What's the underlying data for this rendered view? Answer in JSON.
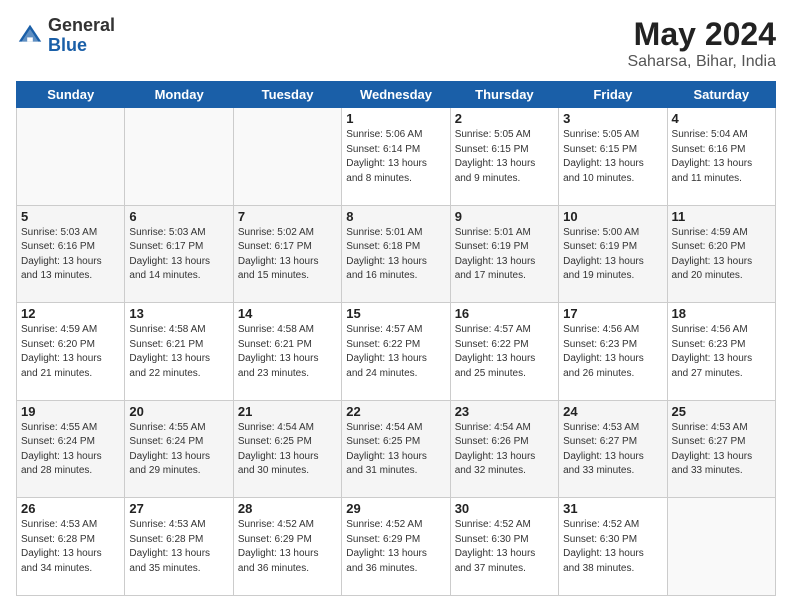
{
  "header": {
    "logo_general": "General",
    "logo_blue": "Blue",
    "month_year": "May 2024",
    "location": "Saharsa, Bihar, India"
  },
  "weekdays": [
    "Sunday",
    "Monday",
    "Tuesday",
    "Wednesday",
    "Thursday",
    "Friday",
    "Saturday"
  ],
  "weeks": [
    [
      {
        "day": "",
        "info": ""
      },
      {
        "day": "",
        "info": ""
      },
      {
        "day": "",
        "info": ""
      },
      {
        "day": "1",
        "info": "Sunrise: 5:06 AM\nSunset: 6:14 PM\nDaylight: 13 hours\nand 8 minutes."
      },
      {
        "day": "2",
        "info": "Sunrise: 5:05 AM\nSunset: 6:15 PM\nDaylight: 13 hours\nand 9 minutes."
      },
      {
        "day": "3",
        "info": "Sunrise: 5:05 AM\nSunset: 6:15 PM\nDaylight: 13 hours\nand 10 minutes."
      },
      {
        "day": "4",
        "info": "Sunrise: 5:04 AM\nSunset: 6:16 PM\nDaylight: 13 hours\nand 11 minutes."
      }
    ],
    [
      {
        "day": "5",
        "info": "Sunrise: 5:03 AM\nSunset: 6:16 PM\nDaylight: 13 hours\nand 13 minutes."
      },
      {
        "day": "6",
        "info": "Sunrise: 5:03 AM\nSunset: 6:17 PM\nDaylight: 13 hours\nand 14 minutes."
      },
      {
        "day": "7",
        "info": "Sunrise: 5:02 AM\nSunset: 6:17 PM\nDaylight: 13 hours\nand 15 minutes."
      },
      {
        "day": "8",
        "info": "Sunrise: 5:01 AM\nSunset: 6:18 PM\nDaylight: 13 hours\nand 16 minutes."
      },
      {
        "day": "9",
        "info": "Sunrise: 5:01 AM\nSunset: 6:19 PM\nDaylight: 13 hours\nand 17 minutes."
      },
      {
        "day": "10",
        "info": "Sunrise: 5:00 AM\nSunset: 6:19 PM\nDaylight: 13 hours\nand 19 minutes."
      },
      {
        "day": "11",
        "info": "Sunrise: 4:59 AM\nSunset: 6:20 PM\nDaylight: 13 hours\nand 20 minutes."
      }
    ],
    [
      {
        "day": "12",
        "info": "Sunrise: 4:59 AM\nSunset: 6:20 PM\nDaylight: 13 hours\nand 21 minutes."
      },
      {
        "day": "13",
        "info": "Sunrise: 4:58 AM\nSunset: 6:21 PM\nDaylight: 13 hours\nand 22 minutes."
      },
      {
        "day": "14",
        "info": "Sunrise: 4:58 AM\nSunset: 6:21 PM\nDaylight: 13 hours\nand 23 minutes."
      },
      {
        "day": "15",
        "info": "Sunrise: 4:57 AM\nSunset: 6:22 PM\nDaylight: 13 hours\nand 24 minutes."
      },
      {
        "day": "16",
        "info": "Sunrise: 4:57 AM\nSunset: 6:22 PM\nDaylight: 13 hours\nand 25 minutes."
      },
      {
        "day": "17",
        "info": "Sunrise: 4:56 AM\nSunset: 6:23 PM\nDaylight: 13 hours\nand 26 minutes."
      },
      {
        "day": "18",
        "info": "Sunrise: 4:56 AM\nSunset: 6:23 PM\nDaylight: 13 hours\nand 27 minutes."
      }
    ],
    [
      {
        "day": "19",
        "info": "Sunrise: 4:55 AM\nSunset: 6:24 PM\nDaylight: 13 hours\nand 28 minutes."
      },
      {
        "day": "20",
        "info": "Sunrise: 4:55 AM\nSunset: 6:24 PM\nDaylight: 13 hours\nand 29 minutes."
      },
      {
        "day": "21",
        "info": "Sunrise: 4:54 AM\nSunset: 6:25 PM\nDaylight: 13 hours\nand 30 minutes."
      },
      {
        "day": "22",
        "info": "Sunrise: 4:54 AM\nSunset: 6:25 PM\nDaylight: 13 hours\nand 31 minutes."
      },
      {
        "day": "23",
        "info": "Sunrise: 4:54 AM\nSunset: 6:26 PM\nDaylight: 13 hours\nand 32 minutes."
      },
      {
        "day": "24",
        "info": "Sunrise: 4:53 AM\nSunset: 6:27 PM\nDaylight: 13 hours\nand 33 minutes."
      },
      {
        "day": "25",
        "info": "Sunrise: 4:53 AM\nSunset: 6:27 PM\nDaylight: 13 hours\nand 33 minutes."
      }
    ],
    [
      {
        "day": "26",
        "info": "Sunrise: 4:53 AM\nSunset: 6:28 PM\nDaylight: 13 hours\nand 34 minutes."
      },
      {
        "day": "27",
        "info": "Sunrise: 4:53 AM\nSunset: 6:28 PM\nDaylight: 13 hours\nand 35 minutes."
      },
      {
        "day": "28",
        "info": "Sunrise: 4:52 AM\nSunset: 6:29 PM\nDaylight: 13 hours\nand 36 minutes."
      },
      {
        "day": "29",
        "info": "Sunrise: 4:52 AM\nSunset: 6:29 PM\nDaylight: 13 hours\nand 36 minutes."
      },
      {
        "day": "30",
        "info": "Sunrise: 4:52 AM\nSunset: 6:30 PM\nDaylight: 13 hours\nand 37 minutes."
      },
      {
        "day": "31",
        "info": "Sunrise: 4:52 AM\nSunset: 6:30 PM\nDaylight: 13 hours\nand 38 minutes."
      },
      {
        "day": "",
        "info": ""
      }
    ]
  ]
}
